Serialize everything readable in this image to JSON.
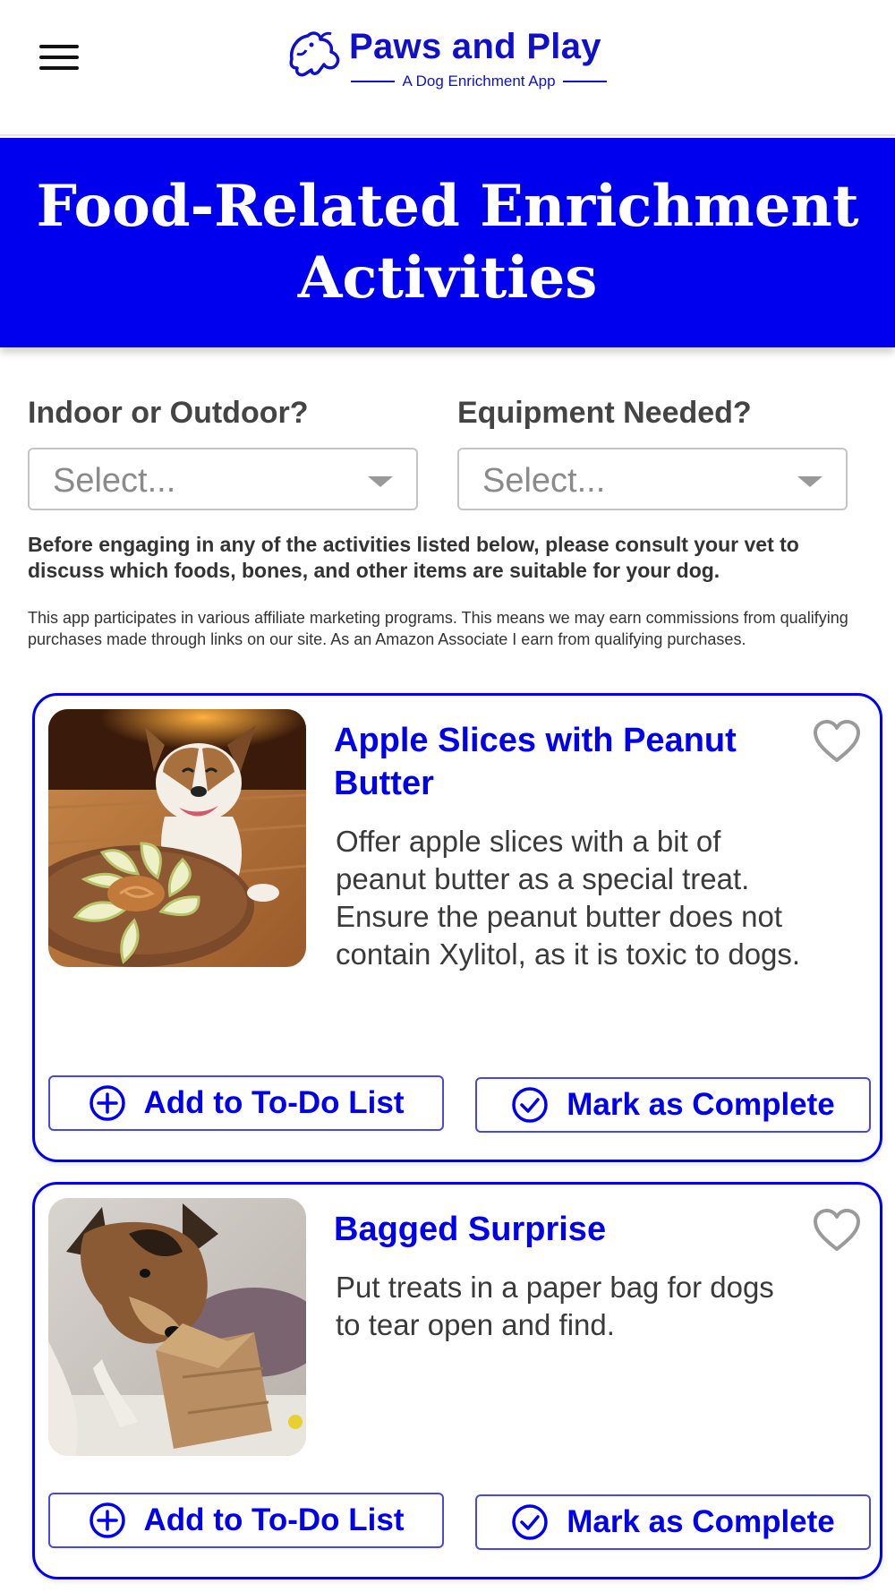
{
  "header": {
    "app_name": "Paws and Play",
    "tagline": "A Dog Enrichment App",
    "brand_color": "#1010c8",
    "menu_icon": "hamburger-menu-icon",
    "logo_icon": "dog-logo-icon"
  },
  "banner": {
    "title": "Food-Related Enrichment Activities",
    "background": "#0000ee"
  },
  "filters": [
    {
      "label": "Indoor or Outdoor?",
      "placeholder": "Select..."
    },
    {
      "label": "Equipment Needed?",
      "placeholder": "Select..."
    }
  ],
  "notice": "Before engaging in any of the activities listed below, please consult your vet to discuss which foods, bones, and other items are suitable for your dog.",
  "disclosure": "This app participates in various affiliate marketing programs. This means we may earn commissions from qualifying purchases made through links on our site. As an Amazon Associate I earn from qualifying purchases.",
  "activities": [
    {
      "title": "Apple Slices with Peanut Butter",
      "description": "Offer apple slices with a bit of peanut butter as a special treat. Ensure the peanut butter does not contain Xylitol, as it is toxic to dogs.",
      "add_label": "Add to To-Do List",
      "complete_label": "Mark as Complete",
      "favorite_icon": "heart-outline-icon",
      "image": "dog-with-apple-slices-and-peanut-butter"
    },
    {
      "title": "Bagged Surprise",
      "description": "Put treats in a paper bag for dogs to tear open and find.",
      "add_label": "Add to To-Do List",
      "complete_label": "Mark as Complete",
      "favorite_icon": "heart-outline-icon",
      "image": "dog-sniffing-paper-bag"
    }
  ]
}
